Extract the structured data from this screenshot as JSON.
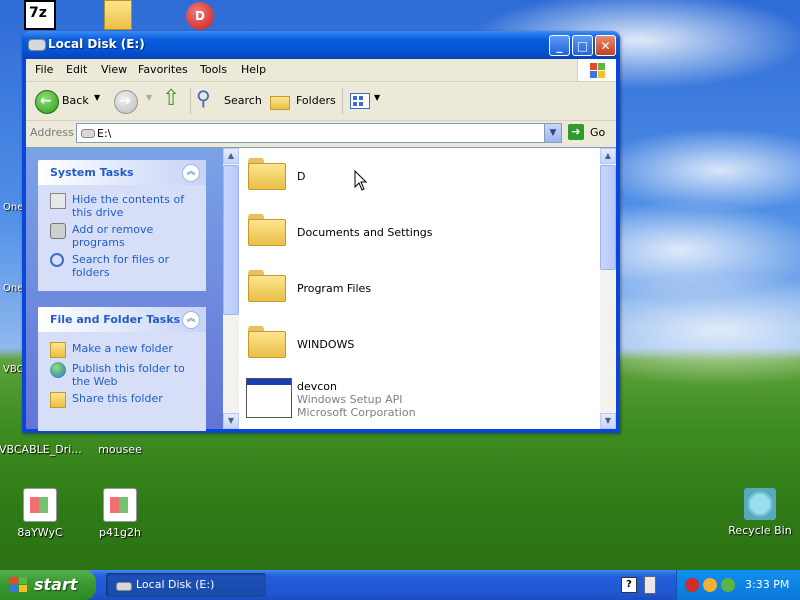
{
  "desktop": {
    "icons": [
      {
        "label": "VBCABLE_Dri...",
        "name": "desktop-icon-vbcable"
      },
      {
        "label": "mousee",
        "name": "desktop-icon-mousee"
      },
      {
        "label": "8aYWyC",
        "name": "desktop-icon-8aywyc"
      },
      {
        "label": "p41g2h",
        "name": "desktop-icon-p41g2h"
      },
      {
        "label": "Recycle Bin",
        "name": "desktop-icon-recycle-bin"
      }
    ],
    "partial_labels": [
      "One",
      "One",
      "VBC"
    ]
  },
  "window": {
    "title": "Local Disk (E:)",
    "menu": [
      "File",
      "Edit",
      "View",
      "Favorites",
      "Tools",
      "Help"
    ],
    "toolbar": {
      "back_label": "Back",
      "search_label": "Search",
      "folders_label": "Folders"
    },
    "address": {
      "label": "Address",
      "value": "E:\\",
      "go_label": "Go"
    },
    "tasks": {
      "system_title": "System Tasks",
      "system_items": [
        "Hide the contents of this drive",
        "Add or remove programs",
        "Search for files or folders"
      ],
      "file_title": "File and Folder Tasks",
      "file_items": [
        "Make a new folder",
        "Publish this folder to the Web",
        "Share this folder"
      ]
    },
    "files": [
      {
        "name": "D",
        "type": "folder"
      },
      {
        "name": "Documents and Settings",
        "type": "folder"
      },
      {
        "name": "Program Files",
        "type": "folder"
      },
      {
        "name": "WINDOWS",
        "type": "folder"
      },
      {
        "name": "devcon",
        "type": "app",
        "line2": "Windows Setup API",
        "line3": "Microsoft Corporation"
      }
    ]
  },
  "taskbar": {
    "start_label": "start",
    "active_task": "Local Disk (E:)",
    "clock": "3:33 PM"
  }
}
